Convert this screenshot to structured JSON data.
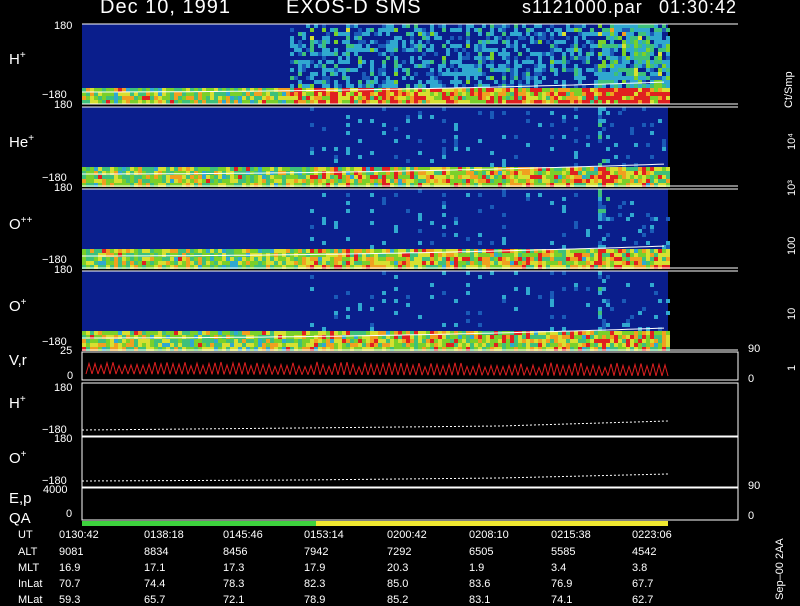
{
  "header": {
    "date": "Dec 10, 1991",
    "instrument": "EXOS-D SMS",
    "file": "s1121000.par",
    "time": "01:30:42"
  },
  "panels": [
    {
      "label": "H",
      "sup": "+",
      "top": "180",
      "bottom": "−180"
    },
    {
      "label": "He",
      "sup": "+",
      "top": "180",
      "bottom": "−180"
    },
    {
      "label": "O",
      "sup": "++",
      "top": "180",
      "bottom": "−180"
    },
    {
      "label": "O",
      "sup": "+",
      "top": "180",
      "bottom": "−180"
    }
  ],
  "vr_panel": {
    "label": "V,r",
    "top": "25",
    "bottom": "0",
    "right_top": "90",
    "right_bottom": "0"
  },
  "line_panels": [
    {
      "label": "H",
      "sup": "+",
      "top": "180",
      "bottom": "−180"
    },
    {
      "label": "O",
      "sup": "+",
      "top": "180",
      "bottom": "−180"
    }
  ],
  "ep_panel": {
    "label": "E,p",
    "top": "4000",
    "bottom": "0",
    "right_top": "90",
    "right_bottom": "0"
  },
  "qa_panel": {
    "label": "QA"
  },
  "colorbar": {
    "unit": "Ct/Smp",
    "ticks": [
      "1",
      "10",
      "100",
      "10³",
      "10⁴"
    ]
  },
  "footer": {
    "version": "Sep–00  2AA",
    "rows": [
      {
        "label": "UT",
        "values": [
          "0130:42",
          "0138:18",
          "0145:46",
          "0153:14",
          "0200:42",
          "0208:10",
          "0215:38",
          "0223:06"
        ]
      },
      {
        "label": "ALT",
        "values": [
          "9081",
          "8834",
          "8456",
          "7942",
          "7292",
          "6505",
          "5585",
          "4542"
        ]
      },
      {
        "label": "MLT",
        "values": [
          "16.9",
          "17.1",
          "17.3",
          "17.9",
          "20.3",
          "1.9",
          "3.4",
          "3.8"
        ]
      },
      {
        "label": "InLat",
        "values": [
          "70.7",
          "74.4",
          "78.3",
          "82.3",
          "85.0",
          "83.6",
          "76.9",
          "67.7"
        ]
      },
      {
        "label": "MLat",
        "values": [
          "59.3",
          "65.7",
          "72.1",
          "78.9",
          "85.2",
          "83.1",
          "74.1",
          "62.7"
        ]
      }
    ]
  },
  "chart_data": {
    "type": "heatmap",
    "title": "Dec 10, 1991   EXOS-D SMS",
    "x_ticks": [
      "0130:42",
      "0138:18",
      "0145:46",
      "0153:14",
      "0200:42",
      "0208:10",
      "0215:38",
      "0223:06"
    ],
    "y_range": [
      -180,
      180
    ],
    "color_scale": "log",
    "color_range": [
      1,
      10000
    ],
    "color_unit": "Ct/Smp",
    "series": [
      {
        "name": "H+",
        "kind": "pitch-angle spectrogram"
      },
      {
        "name": "He+",
        "kind": "pitch-angle spectrogram"
      },
      {
        "name": "O++",
        "kind": "pitch-angle spectrogram"
      },
      {
        "name": "O+",
        "kind": "pitch-angle spectrogram"
      }
    ],
    "qa_segments": [
      {
        "from": "0130:42",
        "to": "0153:14",
        "color": "#3ed23e"
      },
      {
        "from": "0153:14",
        "to": "0223:06",
        "color": "#f0e830"
      }
    ],
    "colors": {
      "background": "#000000",
      "spectrogram_base": "#0a1e8c",
      "trace": "#ffffff",
      "vr_trace": "#e02020"
    }
  }
}
